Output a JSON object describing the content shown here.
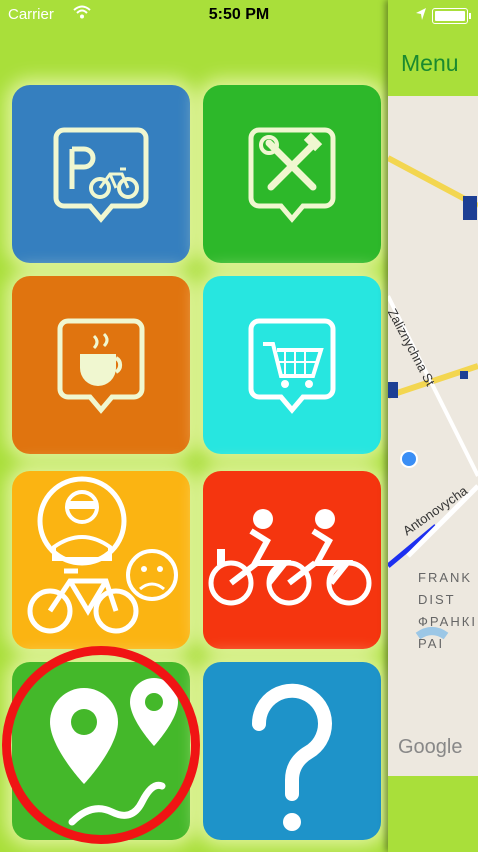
{
  "status_bar": {
    "carrier": "Carrier",
    "time": "5:50 PM"
  },
  "tiles": [
    {
      "name": "bike-parking",
      "icon": "bike-parking-pin-icon",
      "color": "#357fbf"
    },
    {
      "name": "bike-repair",
      "icon": "repair-tools-pin-icon",
      "color": "#2db82a"
    },
    {
      "name": "cafe",
      "icon": "coffee-cup-pin-icon",
      "color": "#e0740f"
    },
    {
      "name": "bike-shop",
      "icon": "shopping-cart-pin-icon",
      "color": "#27e6e0"
    },
    {
      "name": "bike-theft",
      "icon": "thief-bike-icon",
      "color": "#fbb412"
    },
    {
      "name": "group-rides",
      "icon": "cyclists-icon",
      "color": "#f5350f"
    },
    {
      "name": "routes",
      "icon": "route-pins-icon",
      "color": "#44b82a"
    },
    {
      "name": "help",
      "icon": "question-mark-icon",
      "color": "#1e93c9"
    }
  ],
  "map_panel": {
    "menu_label": "Menu",
    "streets": [
      "Zaliznychna St",
      "Antonovycha"
    ],
    "district_lines": [
      "FRANK",
      "DIST",
      "ФРАНКІ",
      "РАІ"
    ],
    "attribution": "Google"
  },
  "colors": {
    "background": "#a9df3a",
    "highlight": "#f01414",
    "menu_text": "#1a8a2f"
  }
}
